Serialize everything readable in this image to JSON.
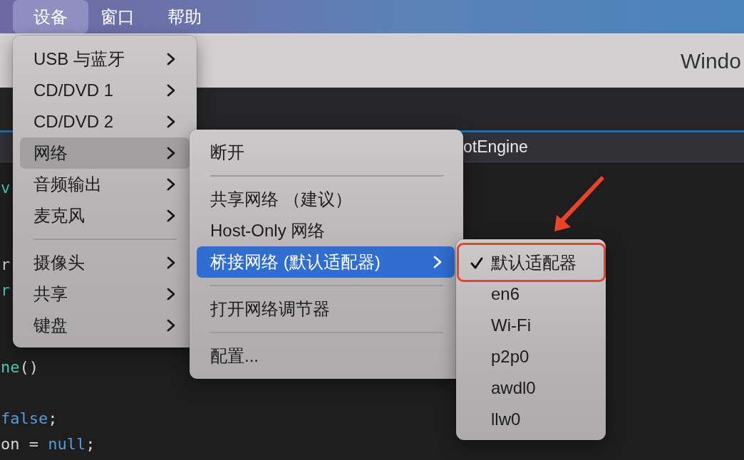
{
  "menu_bar": {
    "items": [
      {
        "label": "设备",
        "selected": true
      },
      {
        "label": "窗口",
        "selected": false
      },
      {
        "label": "帮助",
        "selected": false
      }
    ]
  },
  "window": {
    "title": "Windo"
  },
  "editor": {
    "tab": {
      "label": "otEngine"
    },
    "code_lines": [
      {
        "kind": "code",
        "tokens": [
          {
            "text": "v",
            "kind": "type"
          }
        ]
      },
      {
        "kind": "blank"
      },
      {
        "kind": "blank"
      },
      {
        "kind": "code",
        "tokens": [
          {
            "text": "r",
            "kind": "plain"
          }
        ]
      },
      {
        "kind": "code",
        "tokens": [
          {
            "text": "r",
            "kind": "type"
          }
        ]
      },
      {
        "kind": "blank"
      },
      {
        "kind": "blank"
      },
      {
        "kind": "code",
        "tokens": [
          {
            "text": "ne",
            "kind": "type"
          },
          {
            "text": "()",
            "kind": "plain"
          }
        ]
      },
      {
        "kind": "blank"
      },
      {
        "kind": "code",
        "tokens": [
          {
            "text": "false",
            "kind": "keyword"
          },
          {
            "text": ";",
            "kind": "plain"
          }
        ]
      },
      {
        "kind": "code",
        "tokens": [
          {
            "text": "on = ",
            "kind": "plain"
          },
          {
            "text": "null",
            "kind": "keyword"
          },
          {
            "text": ";",
            "kind": "plain"
          }
        ]
      }
    ]
  },
  "menus": [
    {
      "active": false,
      "items": [
        {
          "kind": "item",
          "label": "USB 与蓝牙",
          "submenu": true,
          "selected": false
        },
        {
          "kind": "item",
          "label": "CD/DVD 1",
          "submenu": true,
          "selected": false
        },
        {
          "kind": "item",
          "label": "CD/DVD 2",
          "submenu": true,
          "selected": false
        },
        {
          "kind": "item",
          "label": "网络",
          "submenu": true,
          "selected": true
        },
        {
          "kind": "item",
          "label": "音频输出",
          "submenu": true,
          "selected": false
        },
        {
          "kind": "item",
          "label": "麦克风",
          "submenu": true,
          "selected": false
        },
        {
          "kind": "separator"
        },
        {
          "kind": "item",
          "label": "摄像头",
          "submenu": true,
          "selected": false
        },
        {
          "kind": "item",
          "label": "共享",
          "submenu": true,
          "selected": false
        },
        {
          "kind": "item",
          "label": "键盘",
          "submenu": true,
          "selected": false
        }
      ]
    },
    {
      "active": true,
      "items": [
        {
          "kind": "item",
          "label": "断开",
          "submenu": false,
          "selected": false
        },
        {
          "kind": "separator"
        },
        {
          "kind": "item",
          "label": "共享网络 （建议）",
          "submenu": false,
          "selected": false
        },
        {
          "kind": "item",
          "label": "Host-Only 网络",
          "submenu": false,
          "selected": false
        },
        {
          "kind": "item",
          "label": "桥接网络 (默认适配器)",
          "submenu": true,
          "selected": true
        },
        {
          "kind": "separator"
        },
        {
          "kind": "item",
          "label": "打开网络调节器",
          "submenu": false,
          "selected": false
        },
        {
          "kind": "separator"
        },
        {
          "kind": "item",
          "label": "配置...",
          "submenu": false,
          "selected": false
        }
      ]
    },
    {
      "items": [
        {
          "kind": "item",
          "label": "默认适配器",
          "checked": true,
          "selected": false,
          "annotated": true
        },
        {
          "kind": "item",
          "label": "en6",
          "checked": false,
          "selected": false,
          "annotated": false
        },
        {
          "kind": "item",
          "label": "Wi-Fi",
          "checked": false,
          "selected": false,
          "annotated": false
        },
        {
          "kind": "item",
          "label": "p2p0",
          "checked": false,
          "selected": false,
          "annotated": false
        },
        {
          "kind": "item",
          "label": "awdl0",
          "checked": false,
          "selected": false,
          "annotated": false
        },
        {
          "kind": "item",
          "label": "llw0",
          "checked": false,
          "selected": false,
          "annotated": false
        }
      ]
    }
  ]
}
